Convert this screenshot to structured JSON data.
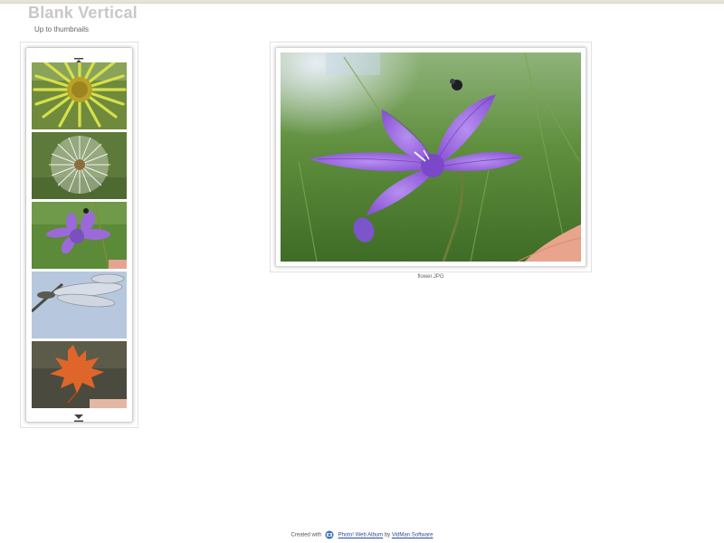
{
  "header": {
    "title": "Blank Vertical",
    "up_link": "Up to thumbnails"
  },
  "strip": {
    "scroll_up_icon": "arrow-up-to-top-icon",
    "scroll_down_icon": "arrow-down-to-bottom-icon",
    "thumbnails": [
      {
        "subject": "yellow daisy"
      },
      {
        "subject": "dandelion seed head"
      },
      {
        "subject": "purple bellflower"
      },
      {
        "subject": "dragonfly wings"
      },
      {
        "subject": "orange maple leaf"
      }
    ]
  },
  "photo": {
    "caption": "flower.JPG"
  },
  "footer": {
    "created_with": "Created with",
    "app_link": "Photo! Web Album",
    "by": "by",
    "vendor_link": "VidMan Software"
  },
  "colors": {
    "title": "#c8c8c8",
    "link": "#2a4c9a",
    "border": "#e2e2e2"
  }
}
